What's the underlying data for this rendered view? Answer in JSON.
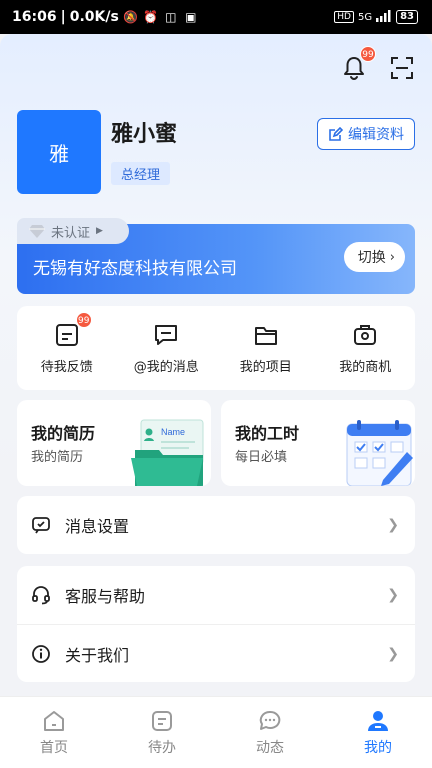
{
  "status_bar": {
    "time": "16:06",
    "net_speed": "0.0K/s",
    "hd_label": "HD",
    "signal_label": "5G",
    "battery": "83"
  },
  "header": {
    "bell_badge": "99",
    "icons": [
      "bell-icon",
      "scan-icon"
    ]
  },
  "profile": {
    "avatar_text": "雅",
    "name": "雅小蜜",
    "role": "总经理",
    "edit_label": "编辑资料"
  },
  "company": {
    "verify_label": "未认证",
    "name": "无锡有好态度科技有限公司",
    "switch_label": "切换"
  },
  "shortcuts": [
    {
      "label": "待我反馈",
      "badge": "99",
      "icon": "feedback-icon"
    },
    {
      "label": "@我的消息",
      "icon": "message-icon"
    },
    {
      "label": "我的项目",
      "icon": "project-icon"
    },
    {
      "label": "我的商机",
      "icon": "opportunity-icon"
    }
  ],
  "features": [
    {
      "title": "我的简历",
      "subtitle": "我的简历",
      "art_label": "Name"
    },
    {
      "title": "我的工时",
      "subtitle": "每日必填"
    }
  ],
  "settings": [
    {
      "label": "消息设置",
      "icon": "message-settings-icon"
    },
    {
      "label": "客服与帮助",
      "icon": "headset-icon"
    },
    {
      "label": "关于我们",
      "icon": "info-icon"
    }
  ],
  "tabs": [
    {
      "label": "首页",
      "icon": "home-icon",
      "active": false
    },
    {
      "label": "待办",
      "icon": "todo-icon",
      "active": false
    },
    {
      "label": "动态",
      "icon": "chat-icon",
      "active": false
    },
    {
      "label": "我的",
      "icon": "user-icon",
      "active": true
    }
  ],
  "colors": {
    "accent": "#1f78ff",
    "badge": "#f5593f"
  }
}
